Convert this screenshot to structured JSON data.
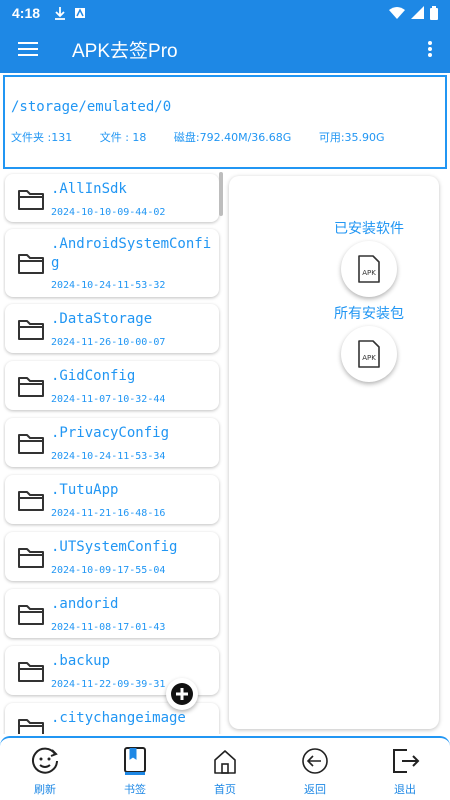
{
  "status_bar": {
    "time": "4:18",
    "icons": [
      "download-icon",
      "app-icon",
      "wifi-icon",
      "signal-icon",
      "battery-icon"
    ]
  },
  "app_bar": {
    "title": "APK去签Pro",
    "menu_icon": "hamburger-menu-icon",
    "more_icon": "more-vert-icon"
  },
  "path_info": {
    "path": "/storage/emulated/0",
    "folders": "文件夹 :131",
    "files": "文件 : 18",
    "disk": "磁盘:792.40M/36.68G",
    "available": "可用:35.90G"
  },
  "files": [
    {
      "name": ".AllInSdk",
      "date": "2024-10-10-09-44-02"
    },
    {
      "name": ".AndroidSystemConfig",
      "date": "2024-10-24-11-53-32"
    },
    {
      "name": ".DataStorage",
      "date": "2024-11-26-10-00-07"
    },
    {
      "name": ".GidConfig",
      "date": "2024-11-07-10-32-44"
    },
    {
      "name": ".PrivacyConfig",
      "date": "2024-10-24-11-53-34"
    },
    {
      "name": ".TutuApp",
      "date": "2024-11-21-16-48-16"
    },
    {
      "name": ".UTSystemConfig",
      "date": "2024-10-09-17-55-04"
    },
    {
      "name": ".andorid",
      "date": "2024-11-08-17-01-43"
    },
    {
      "name": ".backup",
      "date": "2024-11-22-09-39-31"
    },
    {
      "name": ".citychangeimage",
      "date": ""
    }
  ],
  "right_panel": {
    "installed_label": "已安装软件",
    "packages_label": "所有安装包",
    "apk_icon_text": "APK"
  },
  "bottom_nav": [
    {
      "label": "刷新",
      "icon": "refresh-face-icon"
    },
    {
      "label": "书签",
      "icon": "bookmark-icon"
    },
    {
      "label": "首页",
      "icon": "home-icon"
    },
    {
      "label": "返回",
      "icon": "back-arrow-icon"
    },
    {
      "label": "退出",
      "icon": "exit-icon"
    }
  ],
  "colors": {
    "primary": "#1e88e5",
    "accent": "#2196f3",
    "background": "#ffffff"
  }
}
